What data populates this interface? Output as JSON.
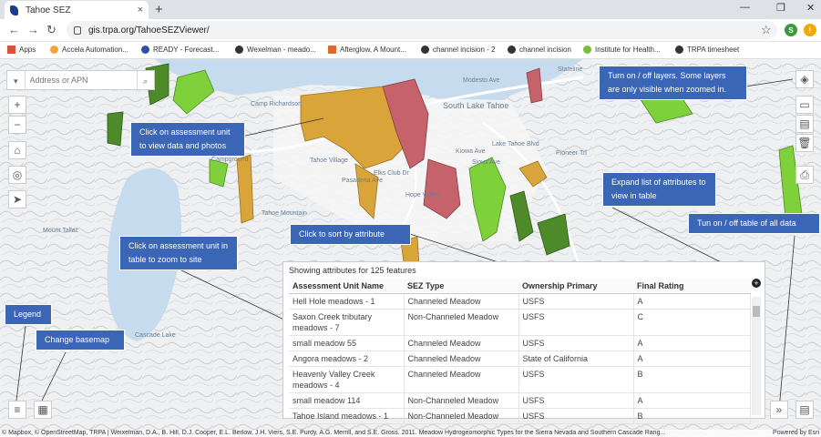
{
  "browser": {
    "tab_title": "Tahoe SEZ",
    "tab_close": "×",
    "new_tab": "+",
    "url": "gis.trpa.org/TahoeSEZViewer/",
    "profile_initial": "S",
    "alert_glyph": "!",
    "window_controls": [
      "—",
      "❐",
      "✕"
    ],
    "nav": [
      "←",
      "→",
      "↻"
    ],
    "star": "☆",
    "bookmarks": [
      {
        "label": "Apps",
        "color": "#e14e3c"
      },
      {
        "label": "Accela Automation...",
        "color": "#f2a33a"
      },
      {
        "label": "READY - Forecast...",
        "color": "#2f4fa6"
      },
      {
        "label": "Wexelman - meado...",
        "color": "#333333"
      },
      {
        "label": "Afterglow, A Mount...",
        "color": "#e2672c"
      },
      {
        "label": "channel incision - 2",
        "color": "#333333"
      },
      {
        "label": "channel incision",
        "color": "#333333"
      },
      {
        "label": "Institute for Health...",
        "color": "#7dbb3a"
      },
      {
        "label": "TRPA timesheet",
        "color": "#333333"
      }
    ]
  },
  "map": {
    "search_placeholder": "Address or APN",
    "search_dropdown_glyph": "▾",
    "search_glyph": "⌕",
    "zoom_in": "+",
    "zoom_out": "−",
    "home_glyph": "⌂",
    "locate_glyph": "◎",
    "navigate_glyph": "➤",
    "right_tools": [
      "◈",
      "▭",
      "▤",
      "🗑",
      "⎙"
    ],
    "legend_glyph": "≡",
    "basemap_glyph": "▦",
    "expand_glyph": "»",
    "table_glyph": "▤",
    "place_labels": [
      "Camp Richardson",
      "South Lake Tahoe",
      "Tahoe Village",
      "Tahoe Mountain",
      "Mount Tallac",
      "Cascade Lake",
      "Campground",
      "Stateline",
      "Pioneer Trl",
      "Lake Tahoe Blvd",
      "Modesto Ave",
      "Kiowa Ave",
      "Sioux Ave",
      "Elks Club Dr",
      "Hope Valley",
      "Pasadena Ave"
    ],
    "attribution": "© Mapbox, © OpenStreetMap, TRPA | Weixelman, D.A., B. Hill, D.J. Cooper, E.L. Berlow, J.H. Viers, S.E. Purdy, A.G. Merrill, and S.E. Gross. 2011. Meadow Hydrogeomorphic Types for the Sierra Nevada and Southern Cascade Rang...",
    "esri": "Powered by Esri"
  },
  "callouts": {
    "layers": "Turn on / off layers. Some layers are only visible when zoomed in.",
    "assessment": "Click on assessment unit to view data and photos",
    "expand": "Expand list of attributes to view in table",
    "table_toggle": "Tun on / off table of all data",
    "sort": "Click to sort by attribute",
    "table_zoom": "Click on assessment unit in table  to zoom to site",
    "legend": "Legend",
    "basemap": "Change basemap"
  },
  "table": {
    "caption": "Showing attributes for 125 features",
    "expand_glyph": "+",
    "columns": [
      "Assessment Unit Name",
      "SEZ Type",
      "Ownership Primary",
      "Final Rating"
    ],
    "rows": [
      [
        "Hell Hole meadows - 1",
        "Channeled Meadow",
        "USFS",
        "A"
      ],
      [
        "Saxon Creek tributary meadows - 7",
        "Non-Channeled Meadow",
        "USFS",
        "C"
      ],
      [
        "small meadow 55",
        "Channeled Meadow",
        "USFS",
        "A"
      ],
      [
        "Angora meadows - 2",
        "Channeled Meadow",
        "State of California",
        "A"
      ],
      [
        "Heavenly Valley Creek meadows - 4",
        "Channeled Meadow",
        "USFS",
        "B"
      ],
      [
        "small meadow 114",
        "Non-Channeled Meadow",
        "USFS",
        "A"
      ],
      [
        "Tahoe Island meadows - 1",
        "Non-Channeled Meadow",
        "USFS",
        "B"
      ]
    ]
  },
  "colors": {
    "accent_callout": "#3a66b5",
    "lake": "#c7dbef",
    "rating_a": "#7fd13b",
    "rating_b": "#d9a53a",
    "rating_c": "#c6636a"
  }
}
